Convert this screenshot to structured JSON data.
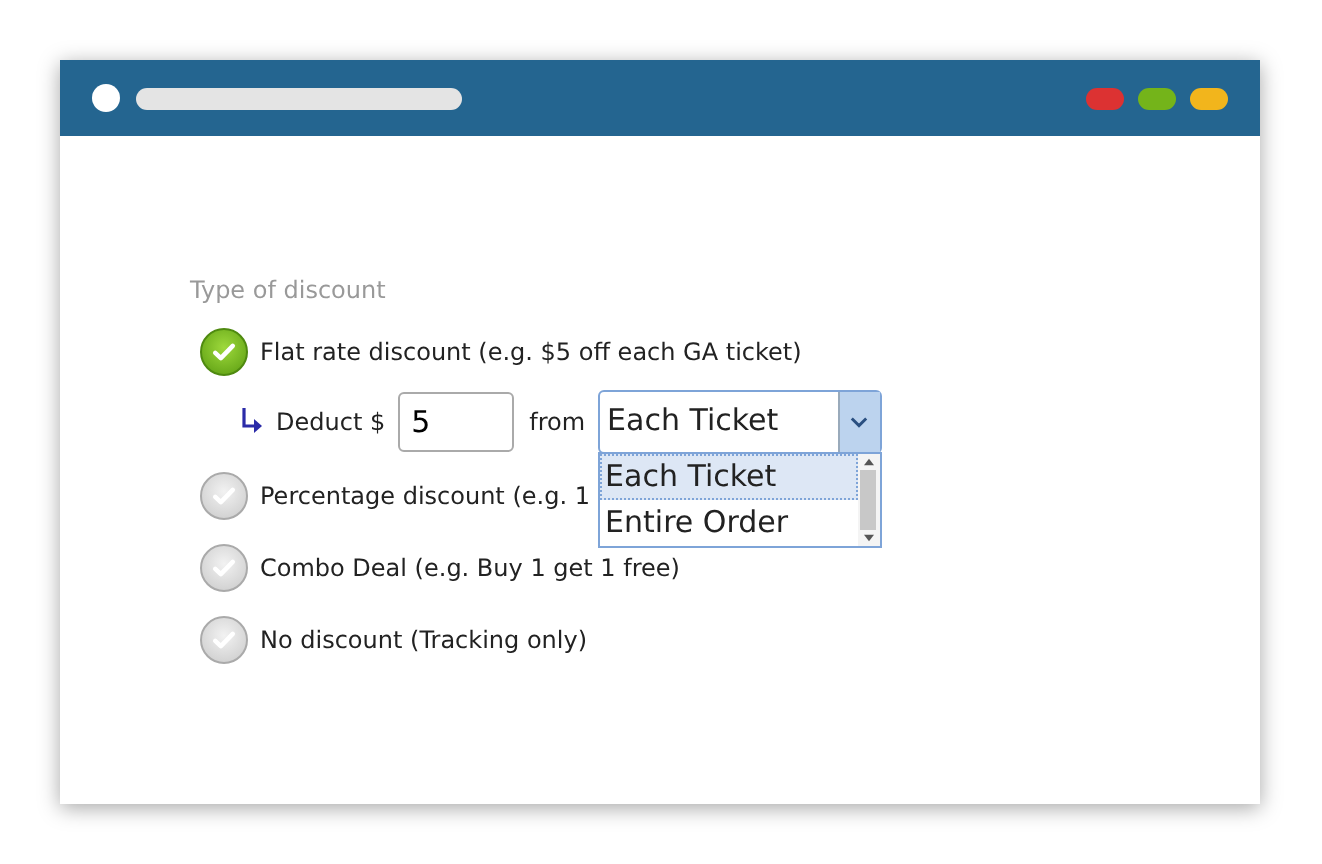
{
  "section_label": "Type of discount",
  "options": [
    {
      "label": "Flat rate discount (e.g. $5 off each GA ticket)",
      "selected": true
    },
    {
      "label": "Percentage discount (e.g. 1",
      "selected": false
    },
    {
      "label": "Combo Deal (e.g. Buy 1 get 1 free)",
      "selected": false
    },
    {
      "label": "No discount (Tracking only)",
      "selected": false
    }
  ],
  "deduct": {
    "label": "Deduct $",
    "value": "5",
    "from_label": "from",
    "select_value": "Each Ticket",
    "expanded": true,
    "choices": [
      {
        "label": "Each Ticket",
        "selected": true
      },
      {
        "label": "Entire Order",
        "selected": false
      }
    ]
  }
}
